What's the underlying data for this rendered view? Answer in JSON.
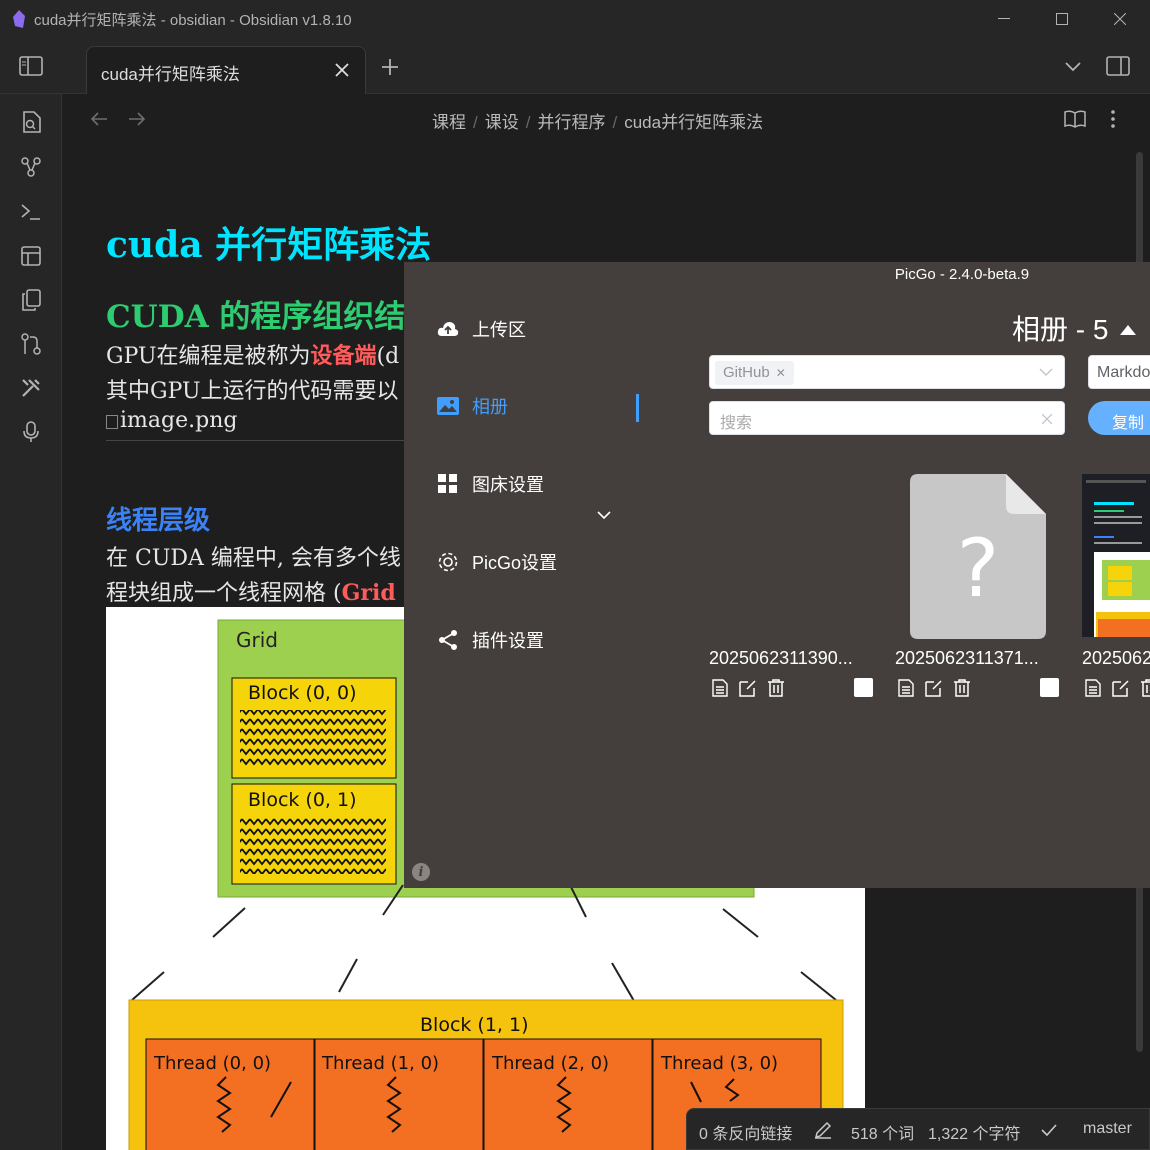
{
  "window": {
    "title": "cuda并行矩阵乘法 - obsidian - Obsidian v1.8.10"
  },
  "tab": {
    "label": "cuda并行矩阵乘法"
  },
  "breadcrumb": [
    "课程",
    "课设",
    "并行程序",
    "cuda并行矩阵乘法"
  ],
  "doc": {
    "title": "cuda 并行矩阵乘法",
    "h2": "CUDA 的程序组织结",
    "p1_a": "GPU在编程是被称为",
    "p1_red": "设备端",
    "p1_b": "(d",
    "p2": "其中GPU上运行的代码需要以",
    "img_alt": "image.png",
    "h3": "线程层级",
    "p3": "在 CUDA 编程中, 会有多个线",
    "p4_a": "程块组成一个线程网格 (",
    "p4_red": "Grid"
  },
  "diagram": {
    "grid_label": "Grid",
    "block_00": "Block (0, 0)",
    "block_01": "Block (0, 1)",
    "block_11": "Block (1, 1)",
    "threads": [
      "Thread (0, 0)",
      "Thread (1, 0)",
      "Thread (2, 0)",
      "Thread (3, 0)"
    ]
  },
  "picgo": {
    "title": "PicGo - 2.4.0-beta.9",
    "menu": [
      "上传区",
      "相册",
      "图床设置",
      "PicGo设置",
      "插件设置"
    ],
    "album_heading": "相册 - 5",
    "filter_chip": "GitHub",
    "search_placeholder": "搜索",
    "format_select": "Markdo",
    "copy_button": "复制",
    "files": [
      "2025062311390...",
      "2025062311371...",
      "2025062"
    ]
  },
  "status": {
    "backlinks": "0 条反向链接",
    "words": "518 个词",
    "chars": "1,322 个字符",
    "branch": "master"
  },
  "colors": {
    "accent_cyan": "#00e5ff",
    "heading_green": "#2ecc71",
    "heading_blue": "#3b82f6",
    "picgo_blue": "#409eff"
  }
}
